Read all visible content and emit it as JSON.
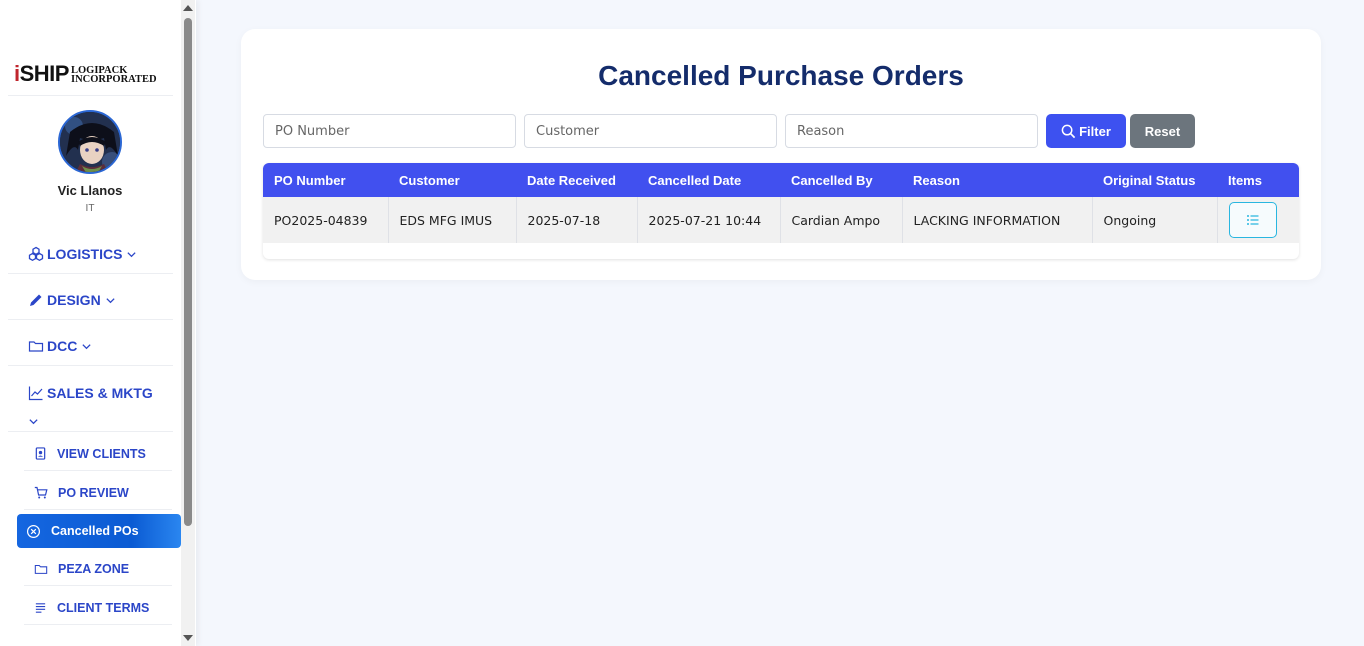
{
  "sidebar": {
    "logo": {
      "big_text": "SHIP",
      "big_initial": "i",
      "small_line1": "LOGIPACK",
      "small_line2": "INCORPORATED"
    },
    "user": {
      "name": "Vic Llanos",
      "role": "IT"
    },
    "sections": [
      {
        "label": "LOGISTICS",
        "icon": "boxes-icon"
      },
      {
        "label": "DESIGN",
        "icon": "pencil-icon"
      },
      {
        "label": "DCC",
        "icon": "folder-icon"
      },
      {
        "label": "SALES & MKTG",
        "icon": "chart-line-icon"
      }
    ],
    "sub_items": [
      {
        "label": "VIEW CLIENTS",
        "icon": "id-card-icon",
        "active": false
      },
      {
        "label": "PO REVIEW",
        "icon": "cart-icon",
        "active": false
      },
      {
        "label": "Cancelled POs",
        "icon": "x-circle-icon",
        "active": true
      },
      {
        "label": "PEZA ZONE",
        "icon": "folder-icon",
        "active": false
      },
      {
        "label": "CLIENT TERMS",
        "icon": "list-icon",
        "active": false
      }
    ]
  },
  "main": {
    "title": "Cancelled Purchase Orders",
    "filters": {
      "po_number_placeholder": "PO Number",
      "customer_placeholder": "Customer",
      "reason_placeholder": "Reason",
      "filter_label": "Filter",
      "reset_label": "Reset"
    },
    "table": {
      "columns": [
        "PO Number",
        "Customer",
        "Date Received",
        "Cancelled Date",
        "Cancelled By",
        "Reason",
        "Original Status",
        "Items"
      ],
      "rows": [
        [
          "PO2025-04839",
          "EDS MFG IMUS",
          "2025-07-18",
          "2025-07-21 10:44",
          "Cardian Ampo",
          "LACKING INFORMATION",
          "Ongoing"
        ]
      ]
    }
  },
  "colors": {
    "accent": "#4150ef",
    "title": "#142c6b",
    "nav": "#2b46c8",
    "active_item": "#0b5bd3",
    "reset": "#6c757d"
  }
}
